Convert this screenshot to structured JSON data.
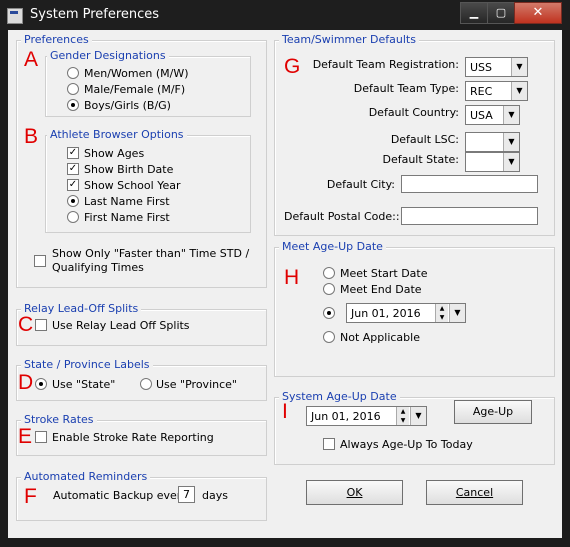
{
  "window": {
    "title": "System Preferences",
    "minimize": "▁",
    "maximize": "▢",
    "close": "✕"
  },
  "preferences": {
    "group_label": "Preferences",
    "markers": {
      "a": "A",
      "b": "B"
    },
    "gender": {
      "label": "Gender Designations",
      "options": [
        "Men/Women (M/W)",
        "Male/Female (M/F)",
        "Boys/Girls (B/G)"
      ],
      "selected": "Boys/Girls (B/G)"
    },
    "athlete_browser": {
      "label": "Athlete Browser Options",
      "show_ages": "Show Ages",
      "show_birth_date": "Show Birth Date",
      "show_school_year": "Show School Year",
      "last_name_first": "Last Name First",
      "first_name_first": "First Name First",
      "check_mark": "✓"
    },
    "faster_than": {
      "line1": "Show Only  \"Faster than\" Time STD /",
      "line2": "Qualifying Times"
    }
  },
  "relay": {
    "group_label": "Relay Lead-Off Splits",
    "marker": "C",
    "checkbox_label": "Use Relay Lead Off Splits"
  },
  "state_labels": {
    "group_label": "State / Province Labels",
    "marker": "D",
    "state_option": "Use \"State\"",
    "province_option": "Use \"Province\""
  },
  "stroke_rates": {
    "group_label": "Stroke Rates",
    "marker": "E",
    "checkbox_label": "Enable Stroke Rate Reporting"
  },
  "reminders": {
    "group_label": "Automated Reminders",
    "marker": "F",
    "prefix": "Automatic Backup every",
    "value": "7",
    "suffix": "days"
  },
  "team_defaults": {
    "group_label": "Team/Swimmer Defaults",
    "marker": "G",
    "registration": {
      "label": "Default Team Registration:",
      "value": "USS"
    },
    "team_type": {
      "label": "Default Team Type:",
      "value": "REC"
    },
    "country": {
      "label": "Default Country:",
      "value": "USA"
    },
    "lsc": {
      "label": "Default LSC:",
      "value": ""
    },
    "state": {
      "label": "Default State:",
      "value": ""
    },
    "city": {
      "label": "Default City:",
      "value": ""
    },
    "postal": {
      "label": "Default Postal Code::",
      "value": ""
    },
    "arrow": "▼"
  },
  "meet_ageup": {
    "group_label": "Meet Age-Up Date",
    "marker": "H",
    "meet_start": "Meet Start Date",
    "meet_end": "Meet End Date",
    "date_value": "Jun 01, 2016",
    "not_applicable": "Not Applicable"
  },
  "system_ageup": {
    "group_label": "System Age-Up Date",
    "marker": "I",
    "date_value": "Jun 01, 2016",
    "ageup_button": "Age-Up",
    "always_label": "Always Age-Up To Today"
  },
  "buttons": {
    "ok": "OK",
    "cancel": "Cancel"
  },
  "spin": {
    "up": "▲",
    "down": "▼"
  }
}
